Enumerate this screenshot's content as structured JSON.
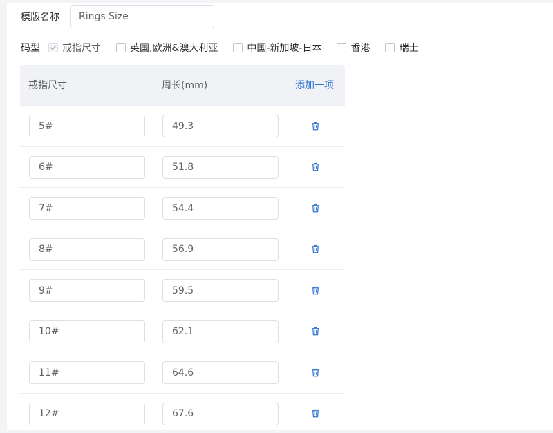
{
  "template": {
    "name_label": "模版名称",
    "name_value": "Rings Size"
  },
  "size_type": {
    "label": "码型",
    "options": [
      {
        "label": "戒指尺寸",
        "checked": true,
        "disabled": true
      },
      {
        "label": "英国,欧洲&澳大利亚",
        "checked": false
      },
      {
        "label": "中国-新加坡-日本",
        "checked": false
      },
      {
        "label": "香港",
        "checked": false
      },
      {
        "label": "瑞士",
        "checked": false
      }
    ]
  },
  "table": {
    "headers": {
      "size": "戒指尺寸",
      "length": "周长(mm)",
      "add": "添加一项"
    },
    "rows": [
      {
        "size": "5#",
        "length": "49.3"
      },
      {
        "size": "6#",
        "length": "51.8"
      },
      {
        "size": "7#",
        "length": "54.4"
      },
      {
        "size": "8#",
        "length": "56.9"
      },
      {
        "size": "9#",
        "length": "59.5"
      },
      {
        "size": "10#",
        "length": "62.1"
      },
      {
        "size": "11#",
        "length": "64.6"
      },
      {
        "size": "12#",
        "length": "67.6"
      }
    ]
  },
  "colors": {
    "accent": "#2f74d0",
    "header_bg": "#f0f2f5",
    "border": "#dcdfe6"
  },
  "icons": {
    "delete": "trash-icon",
    "check": "check-icon"
  }
}
